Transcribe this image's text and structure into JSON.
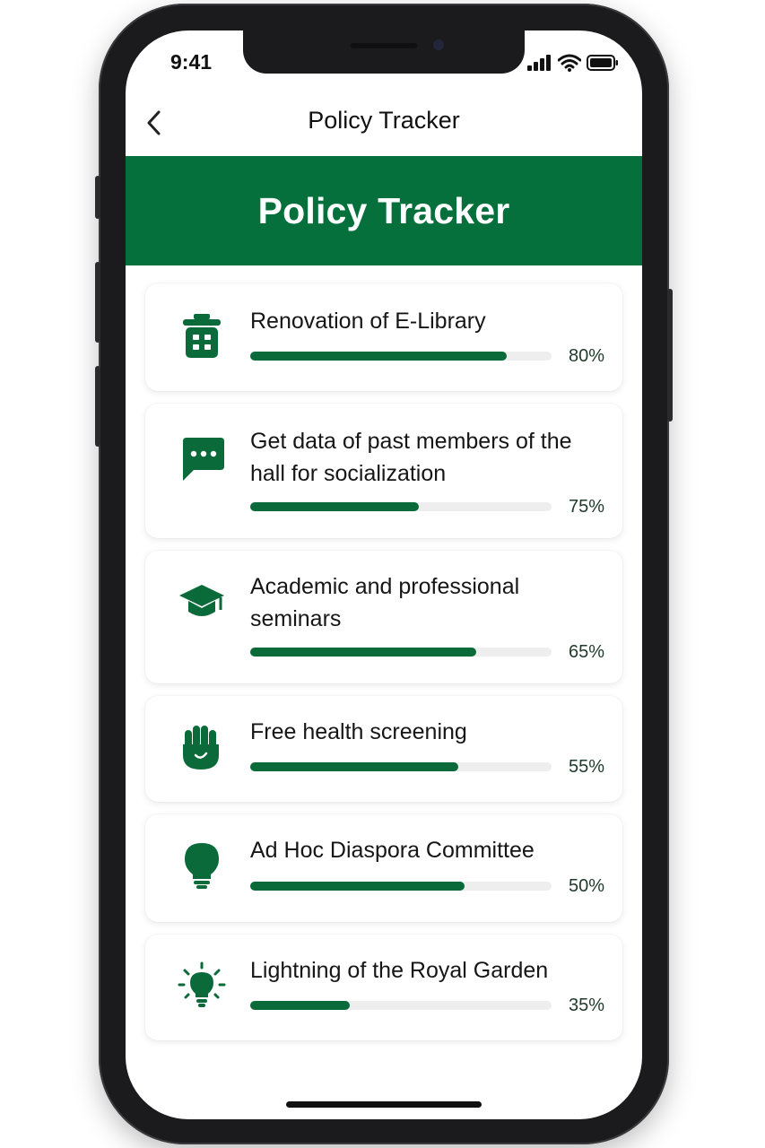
{
  "status_bar": {
    "time": "9:41"
  },
  "nav": {
    "title": "Policy Tracker"
  },
  "banner": {
    "title": "Policy Tracker"
  },
  "policies": [
    {
      "title": "Renovation of E-Library",
      "percent_label": "80%",
      "progress": 0.85,
      "icon": "trash-bin-icon"
    },
    {
      "title": "Get data of past members of the hall for socialization",
      "percent_label": "75%",
      "progress": 0.56,
      "icon": "chat-bubble-icon"
    },
    {
      "title": "Academic and professional seminars",
      "percent_label": "65%",
      "progress": 0.75,
      "icon": "graduation-cap-icon"
    },
    {
      "title": "Free health screening",
      "percent_label": "55%",
      "progress": 0.69,
      "icon": "raised-hand-icon"
    },
    {
      "title": "Ad Hoc Diaspora Committee",
      "percent_label": "50%",
      "progress": 0.71,
      "icon": "light-bulb-icon"
    },
    {
      "title": "Lightning of the Royal Garden",
      "percent_label": "35%",
      "progress": 0.33,
      "icon": "shining-bulb-icon"
    }
  ],
  "colors": {
    "brand_green": "#06703c",
    "bar_green": "#0b6a3a",
    "track_gray": "#eeeeee"
  }
}
